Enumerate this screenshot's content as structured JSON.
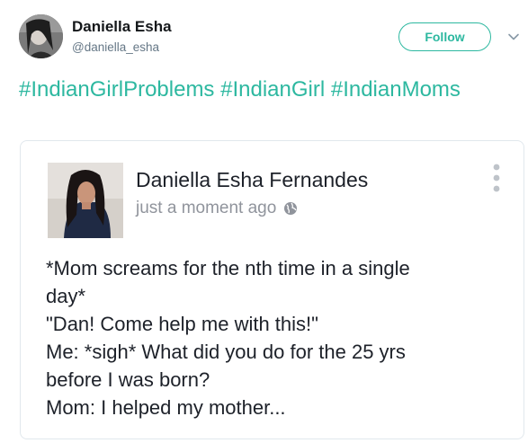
{
  "tweet": {
    "author_name": "Daniella Esha",
    "author_handle": "@daniella_esha",
    "follow_label": "Follow",
    "hashtags": [
      "#IndianGirlProblems",
      "#IndianGirl",
      "#IndianMoms"
    ]
  },
  "embedded_post": {
    "author_name": "Daniella Esha Fernandes",
    "timestamp": "just a moment ago",
    "lines": [
      "*Mom screams for the nth time in a single",
      "day*",
      "\"Dan! Come help me with this!\"",
      "Me: *sigh* What did you do for the 25 yrs",
      "before I was born?",
      "Mom: I helped my mother..."
    ]
  },
  "colors": {
    "accent": "#2db8a0",
    "name": "#14171a",
    "muted": "#657786",
    "border": "#e1e8ed",
    "fb_text": "#1d2129",
    "fb_muted": "#90949c"
  },
  "icons": {
    "dropdown": "chevron-down-icon",
    "privacy": "globe-icon",
    "menu": "more-vertical-icon"
  }
}
